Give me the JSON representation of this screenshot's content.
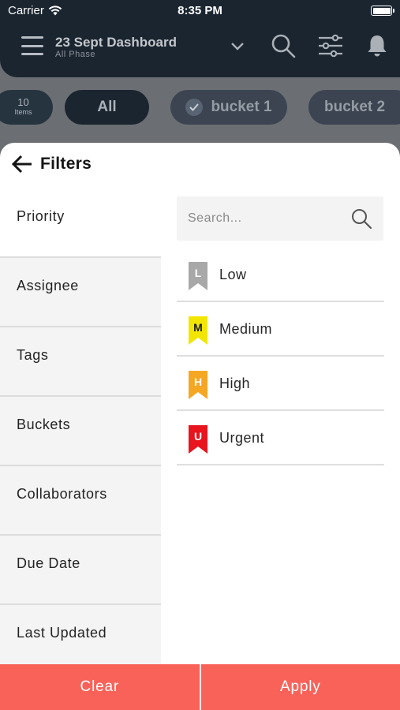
{
  "status": {
    "carrier": "Carrier",
    "time": "8:35 PM"
  },
  "header": {
    "title": "23 Sept Dashboard",
    "subtitle": "All Phase"
  },
  "chips": {
    "count": "10",
    "count_label": "Items",
    "all": "All",
    "bucket1": "bucket 1",
    "bucket2": "bucket 2"
  },
  "filters": {
    "title": "Filters",
    "categories": [
      "Priority",
      "Assignee",
      "Tags",
      "Buckets",
      "Collaborators",
      "Due Date",
      "Last Updated"
    ],
    "search_placeholder": "Search...",
    "options": [
      {
        "letter": "L",
        "label": "Low",
        "color": "#a8a8a8"
      },
      {
        "letter": "M",
        "label": "Medium",
        "color": "#f2e600"
      },
      {
        "letter": "H",
        "label": "High",
        "color": "#f5a623"
      },
      {
        "letter": "U",
        "label": "Urgent",
        "color": "#e8141e"
      }
    ]
  },
  "footer": {
    "clear": "Clear",
    "apply": "Apply"
  }
}
